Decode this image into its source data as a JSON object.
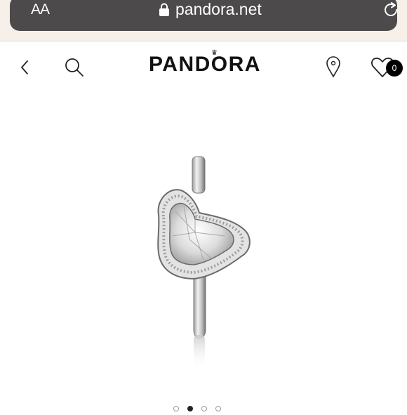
{
  "browser": {
    "text_size_label": "AA",
    "domain": "pandora.net",
    "icons": {
      "lock": "lock-icon",
      "reload": "reload-icon"
    }
  },
  "header": {
    "logo_text": "PANDORA",
    "wishlist_count": "0",
    "icons": {
      "back": "chevron-left-icon",
      "search": "search-icon",
      "location": "location-pin-icon",
      "wishlist": "heart-icon"
    }
  },
  "product": {
    "image": "heart-halo-ring",
    "carousel": {
      "total": 4,
      "active_index": 1
    }
  },
  "colors": {
    "browser_bar": "#4c4a4b",
    "badge": "#000000",
    "accent": "#111111"
  }
}
